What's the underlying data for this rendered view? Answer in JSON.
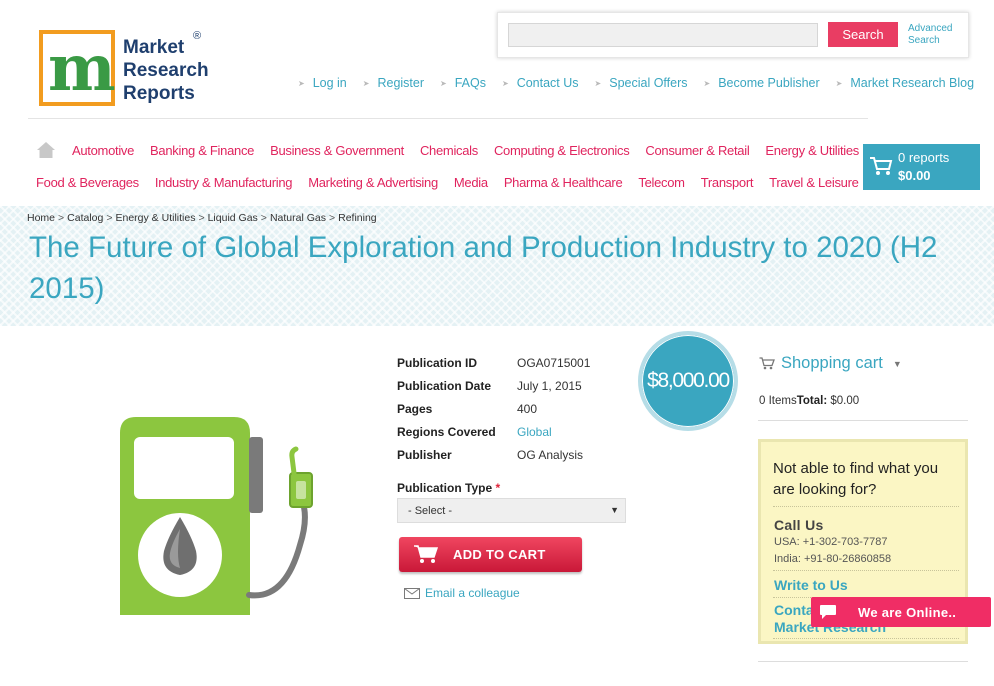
{
  "logo": {
    "lines": [
      "Market",
      "Research",
      "Reports"
    ],
    "registered": "®"
  },
  "search": {
    "placeholder": "",
    "button_label": "Search",
    "advanced_line1": "Advanced",
    "advanced_line2": "Search"
  },
  "top_links": [
    "Log in",
    "Register",
    "FAQs",
    "Contact Us",
    "Special Offers",
    "Become Publisher",
    "Market Research Blog"
  ],
  "nav": {
    "row1": [
      "Automotive",
      "Banking & Finance",
      "Business & Government",
      "Chemicals",
      "Computing & Electronics",
      "Consumer & Retail",
      "Energy & Utilities"
    ],
    "row2": [
      "Food & Beverages",
      "Industry & Manufacturing",
      "Marketing & Advertising",
      "Media",
      "Pharma & Healthcare",
      "Telecom",
      "Transport",
      "Travel & Leisure"
    ]
  },
  "cart_button": {
    "count_text": "0 reports",
    "total_text": "$0.00"
  },
  "breadcrumb": [
    "Home",
    "Catalog",
    "Energy & Utilities",
    "Liquid Gas",
    "Natural Gas",
    "Refining"
  ],
  "breadcrumb_sep": ">",
  "page_title": "The Future of Global Exploration and Production Industry to 2020 (H2 2015)",
  "details": [
    {
      "label": "Publication ID",
      "value": "OGA0715001"
    },
    {
      "label": "Publication Date",
      "value": "July 1, 2015"
    },
    {
      "label": "Pages",
      "value": "400"
    },
    {
      "label": "Regions Covered",
      "value": "Global"
    },
    {
      "label": "Publisher",
      "value": "OG Analysis"
    }
  ],
  "price": "$8,000.00",
  "publication_type": {
    "label": "Publication Type",
    "required_mark": "*",
    "selected": "- Select -"
  },
  "add_to_cart_label": "ADD TO CART",
  "email_colleague_label": "Email a colleague",
  "shopping_cart": {
    "title": "Shopping cart",
    "items_text": "0 Items",
    "total_label": "Total:",
    "total_value": "$0.00"
  },
  "help_box": {
    "question": "Not able to find what you are looking for?",
    "call_us": "Call Us",
    "phone_usa": "USA: +1-302-703-7787",
    "phone_india": "India: +91-80-26860858",
    "write_to_us": "Write to Us",
    "contact_line1": "Contact",
    "contact_line2": "Market Research"
  },
  "chat": {
    "label": "We are Online.."
  },
  "colors": {
    "accent_teal": "#3aa6c0",
    "accent_pink": "#e0245e",
    "button_red": "#e93d63",
    "pump_green": "#8cc63f"
  }
}
